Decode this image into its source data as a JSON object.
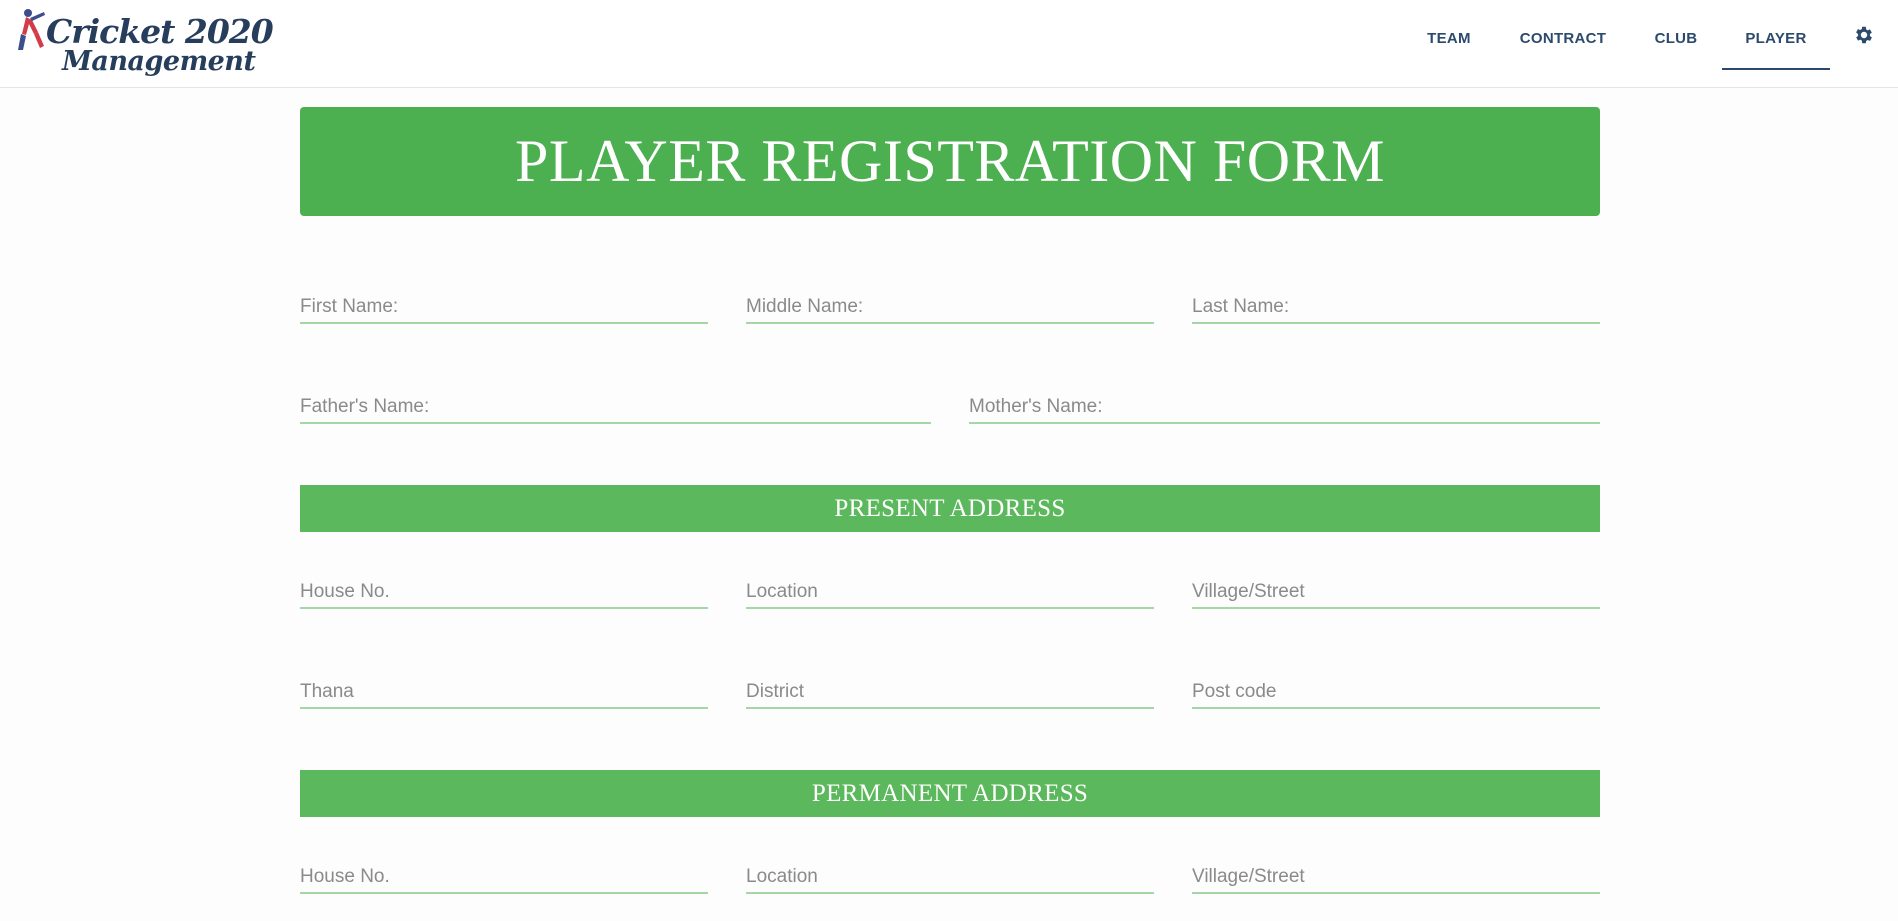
{
  "app": {
    "logo_line1": "Cricket 2020",
    "logo_line2": "Management"
  },
  "nav": {
    "items": [
      {
        "label": "TEAM"
      },
      {
        "label": "CONTRACT"
      },
      {
        "label": "CLUB"
      },
      {
        "label": "PLAYER",
        "active": true
      }
    ],
    "settings_icon": "gear-icon"
  },
  "form": {
    "title": "PLAYER REGISTRATION FORM",
    "name_fields": {
      "first_name": "First Name:",
      "middle_name": "Middle Name:",
      "last_name": "Last Name:",
      "father_name": "Father's Name:",
      "mother_name": "Mother's Name:"
    },
    "present_address": {
      "heading": "PRESENT ADDRESS",
      "house_no": "House No.",
      "location": "Location",
      "village_street": "Village/Street",
      "thana": "Thana",
      "district": "District",
      "post_code": "Post code"
    },
    "permanent_address": {
      "heading": "PERMANENT ADDRESS",
      "house_no": "House No.",
      "location": "Location",
      "village_street": "Village/Street"
    }
  },
  "colors": {
    "banner": "#4caf50",
    "section_bar": "#5cb85c",
    "field_underline": "#a5d6a7",
    "nav_text": "#2c4a6b"
  }
}
